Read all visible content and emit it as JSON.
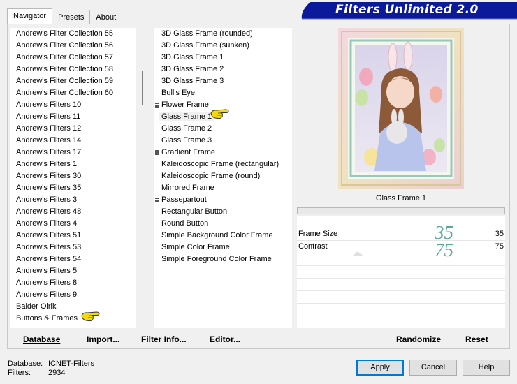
{
  "tabs": [
    {
      "label": "Navigator",
      "active": true
    },
    {
      "label": "Presets",
      "active": false
    },
    {
      "label": "About",
      "active": false
    }
  ],
  "banner": {
    "title": "Filters Unlimited 2.0"
  },
  "categories": [
    "Andrew's Filter Collection 55",
    "Andrew's Filter Collection 56",
    "Andrew's Filter Collection 57",
    "Andrew's Filter Collection 58",
    "Andrew's Filter Collection 59",
    "Andrew's Filter Collection 60",
    "Andrew's Filters 10",
    "Andrew's Filters 11",
    "Andrew's Filters 12",
    "Andrew's Filters 14",
    "Andrew's Filters 17",
    "Andrew's Filters 1",
    "Andrew's Filters 30",
    "Andrew's Filters 35",
    "Andrew's Filters 3",
    "Andrew's Filters 48",
    "Andrew's Filters 4",
    "Andrew's Filters 51",
    "Andrew's Filters 53",
    "Andrew's Filters 54",
    "Andrew's Filters 5",
    "Andrew's Filters 8",
    "Andrew's Filters 9",
    "Balder Olrik",
    "Buttons & Frames"
  ],
  "filters": [
    {
      "label": "3D Glass Frame (rounded)",
      "marker": false
    },
    {
      "label": "3D Glass Frame (sunken)",
      "marker": false
    },
    {
      "label": "3D Glass Frame 1",
      "marker": false
    },
    {
      "label": "3D Glass Frame 2",
      "marker": false
    },
    {
      "label": "3D Glass Frame 3",
      "marker": false
    },
    {
      "label": "Bull's Eye",
      "marker": false
    },
    {
      "label": "Flower Frame",
      "marker": true
    },
    {
      "label": "Glass Frame 1",
      "marker": false,
      "selected": true
    },
    {
      "label": "Glass Frame 2",
      "marker": false
    },
    {
      "label": "Glass Frame 3",
      "marker": false
    },
    {
      "label": "Gradient Frame",
      "marker": true
    },
    {
      "label": "Kaleidoscopic Frame (rectangular)",
      "marker": false
    },
    {
      "label": "Kaleidoscopic Frame (round)",
      "marker": false
    },
    {
      "label": "Mirrored Frame",
      "marker": false
    },
    {
      "label": "Passepartout",
      "marker": true
    },
    {
      "label": "Rectangular Button",
      "marker": false
    },
    {
      "label": "Round Button",
      "marker": false
    },
    {
      "label": "Simple Background Color Frame",
      "marker": false
    },
    {
      "label": "Simple Color Frame",
      "marker": false
    },
    {
      "label": "Simple Foreground Color Frame",
      "marker": false
    }
  ],
  "preview": {
    "filter_name": "Glass Frame 1"
  },
  "params": [
    {
      "label": "Frame Size",
      "value": "35",
      "annotation": "35"
    },
    {
      "label": "Contrast",
      "value": "75",
      "annotation": "75"
    }
  ],
  "buttons": {
    "database": "Database",
    "import": "Import...",
    "filter_info": "Filter Info...",
    "editor": "Editor...",
    "randomize": "Randomize",
    "reset": "Reset",
    "apply": "Apply",
    "cancel": "Cancel",
    "help": "Help"
  },
  "info": {
    "database_label": "Database:",
    "database_value": "ICNET-Filters",
    "filters_label": "Filters:",
    "filters_value": "2934"
  },
  "colors": {
    "banner": "#0b1a9a",
    "accent": "#0078d7",
    "annotation": "#5aa899"
  }
}
